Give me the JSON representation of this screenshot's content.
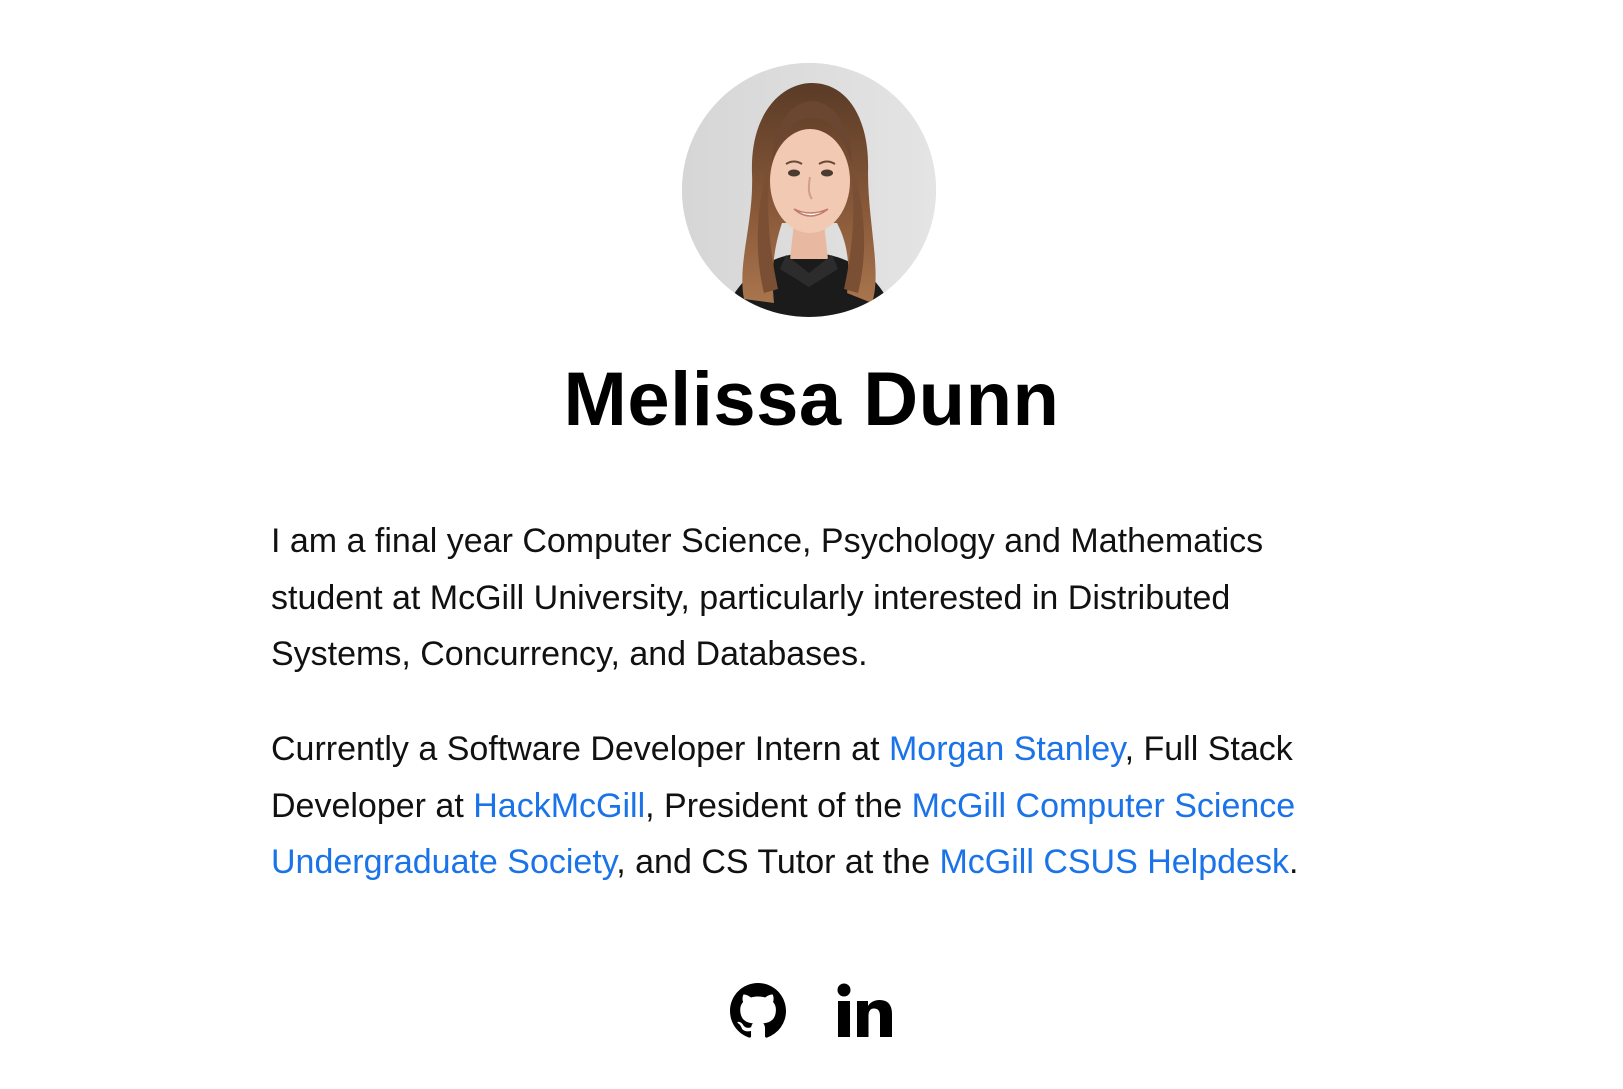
{
  "profile": {
    "name": "Melissa Dunn",
    "avatar_alt": "Melissa Dunn"
  },
  "bio": {
    "paragraph1": "I am a final year Computer Science, Psychology and Mathematics student at McGill University, particularly interested in Distributed Systems, Concurrency, and Databases.",
    "p2_text1": "Currently a Software Developer Intern at ",
    "p2_link1": "Morgan Stanley",
    "p2_text2": ", Full Stack Developer at ",
    "p2_link2": "HackMcGill",
    "p2_text3": ", President of the ",
    "p2_link3": "McGill Computer Science Undergraduate Society",
    "p2_text4": ", and CS Tutor at the ",
    "p2_link4": "McGill CSUS Helpdesk",
    "p2_text5": "."
  },
  "social": {
    "github_icon": "github-icon",
    "linkedin_icon": "linkedin-icon"
  },
  "colors": {
    "link": "#1a73e8",
    "text": "#111111",
    "background": "#ffffff"
  }
}
